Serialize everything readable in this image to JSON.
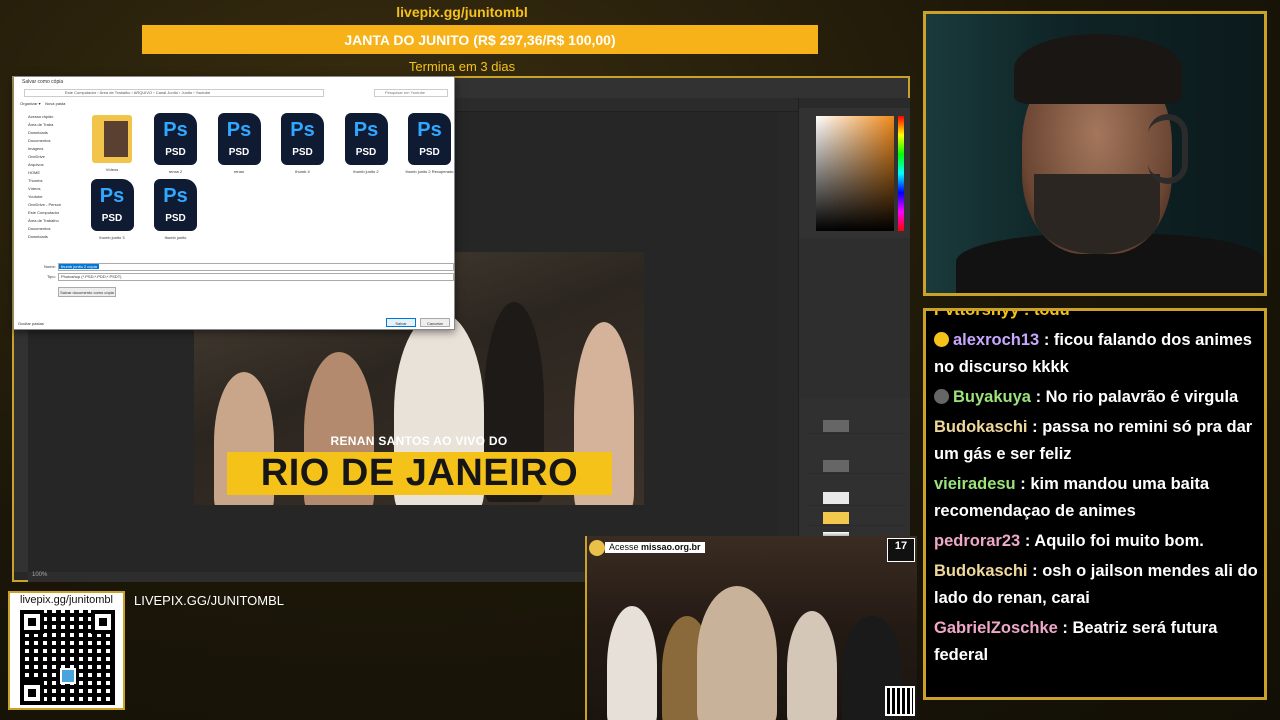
{
  "banner": {
    "pix_url": "livepix.gg/junitombl",
    "goal_text": "JANTA DO JUNITO (R$ 297,36/R$ 100,00)",
    "ends_in": "Termina em 3 dias"
  },
  "photoshop": {
    "thumbnail": {
      "subtitle": "RENAN SANTOS AO VIVO DO",
      "title": "RIO DE JANEIRO"
    },
    "status": "100%"
  },
  "save_dialog": {
    "title": "Salvar como cópia",
    "address": "Este Computador › Área de Trabalho › ARQUIVO › Canal Junito › Junito › Youtube",
    "search_placeholder": "Pesquisar em Youtube",
    "organize": "Organizar ▾",
    "new_folder": "Nova pasta",
    "tree": [
      "Acesso rápido",
      "Área de Traba",
      "Downloads",
      "Documentos",
      "Imagens",
      "OneDrive",
      "Arquivos",
      "HOME",
      "Thumbs",
      "Vídeos",
      "Youtube",
      "OneDrive - Person",
      "Este Computador",
      "Área de Trabalho",
      "Documentos",
      "Downloads"
    ],
    "files": [
      {
        "label": "Vídeos",
        "type": "folder"
      },
      {
        "label": "renan 2",
        "type": "psd"
      },
      {
        "label": "renan",
        "type": "psd"
      },
      {
        "label": "thumb 4",
        "type": "psd"
      },
      {
        "label": "thumb junito 2",
        "type": "psd"
      },
      {
        "label": "thumb junito 2 Recuperado",
        "type": "psd"
      },
      {
        "label": "thumb junito 3",
        "type": "psd"
      },
      {
        "label": "thumb junito",
        "type": "psd"
      }
    ],
    "name_label": "Nome:",
    "type_label": "Tipo:",
    "filename": "thumb junito 2 cópia",
    "filetype": "Photoshop (*.PSD;*.PDD;*.PSDT)",
    "save_copy_label": "Salvar documento como cópia",
    "hide_folders": "Ocultar pastas",
    "save": "Salvar",
    "cancel": "Cancelar",
    "psd_label": "Ps",
    "psd_ext": "PSD"
  },
  "chat": {
    "partial_line": "Pvttorsnyy : todu",
    "messages": [
      {
        "user": "alexroch13",
        "color": "#c8a7ff",
        "badge": "#f5c21a",
        "text": ": ficou falando dos animes no discurso kkkk"
      },
      {
        "user": "Buyakuya",
        "color": "#9be37a",
        "badge": "#666666",
        "text": ": No rio palavrão é virgula"
      },
      {
        "user": "Budokaschi",
        "color": "#f0d79a",
        "badge": "",
        "text": ": passa no remini só pra dar um gás e ser feliz"
      },
      {
        "user": "vieiradesu",
        "color": "#9be37a",
        "badge": "",
        "text": ": kim mandou uma baita recomendaçao de animes"
      },
      {
        "user": "pedrorar23",
        "color": "#f0a8c8",
        "badge": "",
        "text": ": Aquilo foi muito bom."
      },
      {
        "user": "Budokaschi",
        "color": "#f0d79a",
        "badge": "",
        "text": ": osh o jailson mendes ali do lado do renan, carai"
      },
      {
        "user": "GabrielZoschke",
        "color": "#f0a8c8",
        "badge": "",
        "text": ": Beatriz será futura federal"
      }
    ]
  },
  "bottom": {
    "qr_label": "livepix.gg/junitombl",
    "pix_caption": "LIVEPIX.GG/JUNITOMBL"
  },
  "news": {
    "access_prefix": "Acesse",
    "access_url": "missao.org.br",
    "age": "17"
  },
  "colors": {
    "accent": "#f7b21a",
    "frame": "#c9a227",
    "chat_bg": "#000000"
  }
}
